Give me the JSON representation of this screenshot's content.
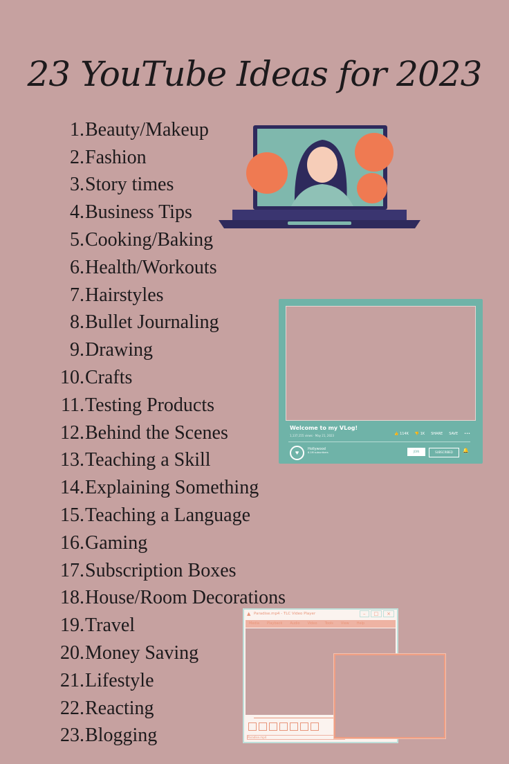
{
  "title": "23 YouTube Ideas for 2023",
  "items": [
    {
      "n": "1.",
      "t": "Beauty/Makeup"
    },
    {
      "n": "2.",
      "t": "Fashion"
    },
    {
      "n": "3.",
      "t": "Story times"
    },
    {
      "n": "4.",
      "t": "Business Tips"
    },
    {
      "n": "5.",
      "t": "Cooking/Baking"
    },
    {
      "n": "6.",
      "t": "Health/Workouts"
    },
    {
      "n": "7.",
      "t": "Hairstyles"
    },
    {
      "n": "8.",
      "t": "Bullet Journaling"
    },
    {
      "n": "9.",
      "t": "Drawing"
    },
    {
      "n": "10.",
      "t": "Crafts"
    },
    {
      "n": "11.",
      "t": "Testing Products"
    },
    {
      "n": "12.",
      "t": "Behind the Scenes"
    },
    {
      "n": "13.",
      "t": "Teaching a Skill"
    },
    {
      "n": "14.",
      "t": "Explaining Something"
    },
    {
      "n": "15.",
      "t": "Teaching a Language"
    },
    {
      "n": "16.",
      "t": "Gaming"
    },
    {
      "n": "17.",
      "t": "Subscription Boxes"
    },
    {
      "n": "18.",
      "t": "House/Room Decorations"
    },
    {
      "n": "19.",
      "t": "Travel"
    },
    {
      "n": "20.",
      "t": "Money Saving"
    },
    {
      "n": "21.",
      "t": "Lifestyle"
    },
    {
      "n": "22.",
      "t": "Reacting"
    },
    {
      "n": "23.",
      "t": "Blogging"
    }
  ],
  "youtube": {
    "video_title": "Welcome to my VLog!",
    "stats": "1,137,155 views · May 21, 2023",
    "likes": "114K",
    "dislikes": "1K",
    "share": "SHARE",
    "save": "SAVE",
    "channel": "Hollywood",
    "subscribers": "8.1M subscribers",
    "join": "JOIN",
    "subscribed": "SUBSCRIBED"
  },
  "player": {
    "title": "Paradise.mp4 - TLC Video Player",
    "menu": [
      "Media",
      "Playback",
      "Audio",
      "Video",
      "Tools",
      "View",
      "Help"
    ],
    "status": "Paradise.mp4"
  },
  "colors": {
    "background": "#c6a1a0",
    "teal": "#6fb3a8",
    "coral": "#ef9e83",
    "navy": "#2e2a5c"
  }
}
